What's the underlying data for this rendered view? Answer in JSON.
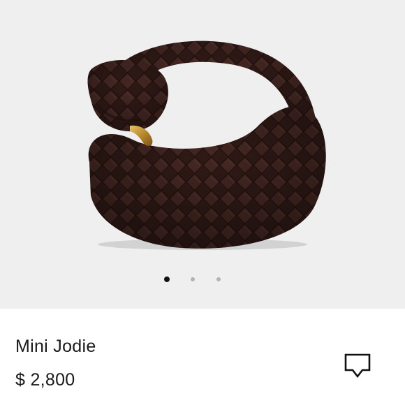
{
  "gallery": {
    "image_icon": "woven-leather-knot-handbag",
    "bag_color": "#3a201c",
    "background_color": "#efefef",
    "slide_count": 3,
    "active_slide": 1
  },
  "product": {
    "name": "Mini Jodie",
    "price": "$ 2,800"
  },
  "actions": {
    "comment_icon": "comment-icon"
  }
}
